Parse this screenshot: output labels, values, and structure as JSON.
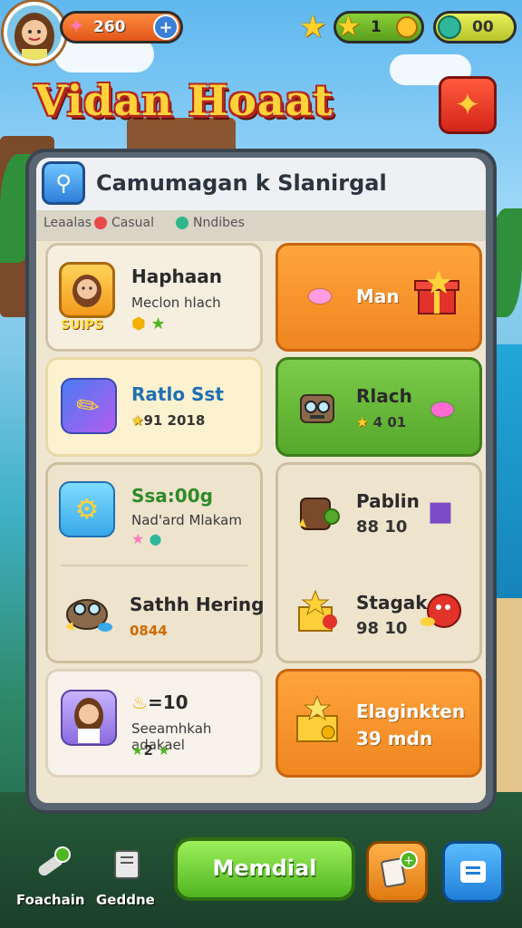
{
  "hud": {
    "coins": "260",
    "stars": "1",
    "gems": "00",
    "plus": "+"
  },
  "title": "Vidan Hoaat",
  "panel": {
    "title": "Camumagan k Slanirgal",
    "tabs": [
      {
        "label": "Leaalas"
      },
      {
        "label": "Casual"
      },
      {
        "label": "Nndibes"
      }
    ]
  },
  "cards": [
    {
      "title": "Haphaan",
      "sub": "Meclon hlach",
      "badge": "SUIPS"
    },
    {
      "title": "Man"
    },
    {
      "title": "Ratlo Sst",
      "meta": "91 2018"
    },
    {
      "title": "Rlach",
      "meta": "4 01"
    },
    {
      "title": "Ssa:00g",
      "sub": "Nad'ard Mlakam"
    },
    {
      "title": "Pablin",
      "meta": "88 10"
    },
    {
      "title": "Sathh Hering",
      "meta": "0844"
    },
    {
      "title": "Stagak",
      "meta": "98 10"
    },
    {
      "title": "=10",
      "sub": "Seeamhkah adakael",
      "meta": "2"
    },
    {
      "title": "Elaginkten",
      "sub": "39 mdn"
    }
  ],
  "bottom": {
    "left_label": "Foachain",
    "mid_label": "Geddne",
    "main_button": "Memdial"
  },
  "colors": {
    "accent": "#ffd23a",
    "green": "#55a82b",
    "orange": "#f08620"
  }
}
